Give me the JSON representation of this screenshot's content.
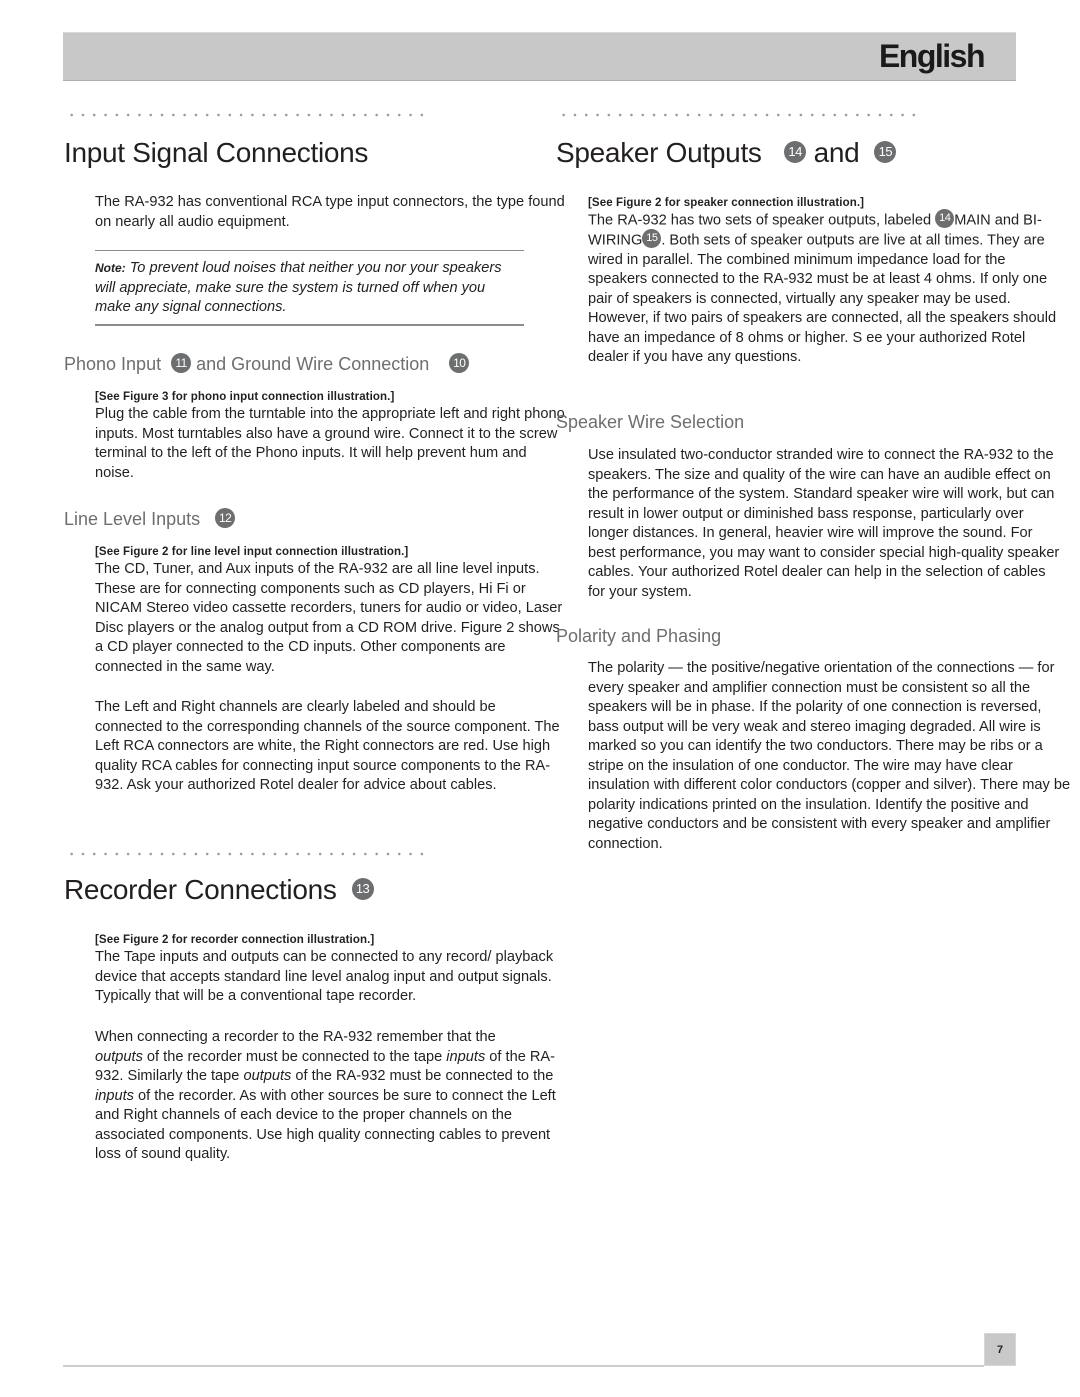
{
  "header": {
    "language_label": "English"
  },
  "left": {
    "input_signal": {
      "title": "Input Signal Connections",
      "intro": "The RA-932 has conventional RCA type input connectors, the type found on nearly all audio equipment.",
      "note_label": "Note:",
      "note_text": "To prevent loud noises that neither you nor your speakers will appreciate, make sure the system is turned off when you make any signal connections."
    },
    "phono": {
      "title_part1": "Phono Input",
      "badge1": "11",
      "title_part2": "and Ground Wire Connection",
      "badge2": "10",
      "figref": "[See Figure 3 for phono input connection illustration.]",
      "body": "Plug the cable from the turntable into the appropriate left and right phono inputs. Most turntables also have a  ground  wire. Connect it to the screw terminal to the left of the Phono inputs. It will help prevent hum and noise."
    },
    "line_level": {
      "title": "Line Level Inputs",
      "badge": "12",
      "figref": "[See Figure 2 for line level input connection illustration.]",
      "body1": "The CD, Tuner, and Aux inputs of the RA-932 are all  line level  inputs. These are for connecting components such as CD players, Hi Fi or NICAM Stereo video cassette recorders, tuners for audio or video, Laser Disc players or the analog output from a CD ROM drive.  Figure 2 shows a CD player connected to the CD inputs. Other components are connected in the same way.",
      "body2": "The Left and Right channels are clearly labeled and should be connected to the corresponding channels of the source component. The Left RCA connectors are white, the Right connectors are red. Use high quality RCA cables for connecting input source components to the RA-932. Ask your authorized Rotel dealer for advice about cables."
    },
    "recorder": {
      "title": "Recorder Connections",
      "badge": "13",
      "figref": "[See Figure 2 for recorder connection illustration.]",
      "body1": "The Tape inputs and outputs can be connected to any record/ playback device that accepts standard line level analog input and output signals. Typically that will be a conventional tape recorder.",
      "body2_a": "When connecting a recorder to the RA-932 remember that the",
      "body2_em1": "outputs",
      "body2_b": " of the recorder must be connected to the tape ",
      "body2_em2": "inputs",
      "body2_c": " of the RA-932. Similarly the tape ",
      "body2_em3": "outputs",
      "body2_d": " of the RA-932 must be connected to the ",
      "body2_em4": "inputs",
      "body2_e": " of the recorder. As with other sources be sure to connect the Left and Right channels of each device to the proper channels on the associated components. Use high quality connecting cables to prevent loss of sound quality."
    }
  },
  "right": {
    "speaker_outputs": {
      "title_part1": "Speaker Outputs",
      "badge1": "14",
      "title_and": "and",
      "badge2": "15",
      "figref": "[See Figure 2 for speaker connection illustration.]",
      "body_a": "The RA-932 has two sets of speaker outputs, labeled ",
      "body_badge1": "14",
      "body_b": "MAIN and BI-WIRING",
      "body_badge2": "15",
      "body_c": ". Both sets of speaker outputs are  live  at all times. They are wired in parallel. The combined minimum impedance load for the speakers connected to the RA-932 must be at least 4 ohms. If only one pair of speakers is connected, virtually any speaker may be used. However, if two pairs of speakers are connected, all the speakers should have an impedance of 8 ohms or higher. S ee your authorized Rotel dealer if you have any questions."
    },
    "wire_selection": {
      "title": "Speaker Wire Selection",
      "body": "Use insulated two-conductor stranded wire to connect the RA-932 to the speakers. The size and quality of the wire can have an audible effect on the performance of the system. Standard speaker wire will work, but can result in lower output or diminished bass response, particularly over longer distances. In general, heavier wire will improve the sound. For best performance, you may want to consider special high-quality speaker cables. Your authorized Rotel dealer can help in the selection of cables for your system."
    },
    "polarity": {
      "title": "Polarity and Phasing",
      "body": "The polarity — the positive/negative orientation of the connections — for every speaker and amplifier connection must be consistent so all the speakers will be in phase. If the polarity of one connection is reversed, bass output will be very weak and stereo imaging degraded. All wire is marked so you can identify the two conductors. There may be ribs or a stripe on the insulation of one conductor. The wire may have clear insulation with different color conductors (copper and silver). There may be polarity indications printed on the insulation. Identify the positive and negative conductors and be consistent with every speaker and amplifier connection."
    }
  },
  "footer": {
    "page_number": "7"
  }
}
